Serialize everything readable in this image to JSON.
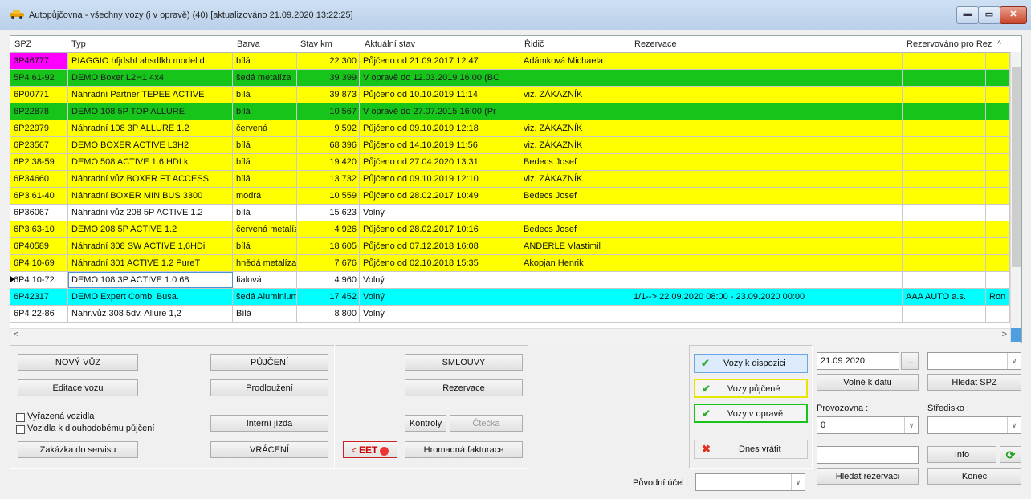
{
  "window": {
    "title": "Autopůjčovna  - všechny vozy (i v opravě) (40) [aktualizováno 21.09.2020 13:22:25]",
    "min_icon": "minimize-icon",
    "max_icon": "maximize-icon",
    "close_icon": "close-icon"
  },
  "grid": {
    "columns": [
      "SPZ",
      "Typ",
      "Barva",
      "Stav km",
      "Aktuální stav",
      "Řidič",
      "Rezervace",
      "Rezervováno pro Rez"
    ],
    "rows": [
      {
        "spz": "3P46777",
        "typ": "PIAGGIO hfjdshf ahsdfkh model d",
        "barva": "bílá",
        "km": "22 300",
        "stav": "Půjčeno od 21.09.2017 12:47",
        "ridic": "Adámková Michaela",
        "rez": "",
        "rezpro": "",
        "color": "yellow",
        "spz_magenta": true
      },
      {
        "spz": "5P4 61-92",
        "typ": "DEMO Boxer L2H1 4x4",
        "barva": "šedá metalíza",
        "km": "39 399",
        "stav": "V opravě do 12.03.2019 16:00 (BC",
        "ridic": "",
        "rez": "",
        "rezpro": "",
        "color": "green"
      },
      {
        "spz": "6P00771",
        "typ": "Náhradní Partner TEPEE ACTIVE",
        "barva": "bílá",
        "km": "39 873",
        "stav": "Půjčeno od 10.10.2019 11:14",
        "ridic": "viz. ZÁKAZNÍK",
        "rez": "",
        "rezpro": "",
        "color": "yellow"
      },
      {
        "spz": "6P22878",
        "typ": "DEMO 108 5P TOP ALLURE",
        "barva": "bílá",
        "km": "10 567",
        "stav": "V opravě do 27.07.2015 16:00 (Pr",
        "ridic": "",
        "rez": "",
        "rezpro": "",
        "color": "green"
      },
      {
        "spz": "6P22979",
        "typ": "Náhradní 108 3P ALLURE 1.2",
        "barva": "červená",
        "km": "9 592",
        "stav": "Půjčeno od 09.10.2019 12:18",
        "ridic": "viz. ZÁKAZNÍK",
        "rez": "",
        "rezpro": "",
        "color": "yellow"
      },
      {
        "spz": "6P23567",
        "typ": "DEMO BOXER ACTIVE L3H2",
        "barva": "bílá",
        "km": "68 396",
        "stav": "Půjčeno od 14.10.2019 11:56",
        "ridic": "viz. ZÁKAZNÍK",
        "rez": "",
        "rezpro": "",
        "color": "yellow"
      },
      {
        "spz": "6P2 38-59",
        "typ": "DEMO 508 ACTIVE 1.6 HDI k",
        "barva": "bílá",
        "km": "19 420",
        "stav": "Půjčeno od 27.04.2020 13:31",
        "ridic": "Bedecs Josef",
        "rez": "",
        "rezpro": "",
        "color": "yellow"
      },
      {
        "spz": "6P34660",
        "typ": "Náhradní vůz BOXER FT ACCESS",
        "barva": "bílá",
        "km": "13 732",
        "stav": "Půjčeno od 09.10.2019 12:10",
        "ridic": "viz. ZÁKAZNÍK",
        "rez": "",
        "rezpro": "",
        "color": "yellow"
      },
      {
        "spz": "6P3 61-40",
        "typ": "Náhradní  BOXER MINIBUS 3300",
        "barva": "modrá",
        "km": "10 559",
        "stav": "Půjčeno od 28.02.2017 10:49",
        "ridic": "Bedecs Josef",
        "rez": "",
        "rezpro": "",
        "color": "yellow"
      },
      {
        "spz": "6P36067",
        "typ": "Náhradní vůz 208 5P ACTIVE 1.2",
        "barva": "bílá",
        "km": "15 623",
        "stav": "Volný",
        "ridic": "",
        "rez": "",
        "rezpro": "",
        "color": "white"
      },
      {
        "spz": "6P3 63-10",
        "typ": "DEMO 208 5P ACTIVE 1.2",
        "barva": "červená metalíz",
        "km": "4 926",
        "stav": "Půjčeno od 28.02.2017 10:16",
        "ridic": "Bedecs Josef",
        "rez": "",
        "rezpro": "",
        "color": "yellow"
      },
      {
        "spz": "6P40589",
        "typ": "Náhradní 308 SW ACTIVE 1,6HDi",
        "barva": "bílá",
        "km": "18 605",
        "stav": "Půjčeno od 07.12.2018 16:08",
        "ridic": "ANDERLE Vlastimil",
        "rez": "",
        "rezpro": "",
        "color": "yellow"
      },
      {
        "spz": "6P4 10-69",
        "typ": "Náhradní 301 ACTIVE 1.2 PureT",
        "barva": "hnědá metalíza",
        "km": "7 676",
        "stav": "Půjčeno od 02.10.2018 15:35",
        "ridic": "Akopjan Henrik",
        "rez": "",
        "rezpro": "",
        "color": "yellow"
      },
      {
        "spz": "6P4 10-72",
        "typ": "DEMO 108 3P ACTIVE 1.0 68",
        "barva": "fialová",
        "km": "4 960",
        "stav": "Volný",
        "ridic": "",
        "rez": "",
        "rezpro": "",
        "color": "white",
        "selected": true
      },
      {
        "spz": "6P42317",
        "typ": "DEMO Expert Combi Busa.",
        "barva": "šedá Aluminium",
        "km": "17 452",
        "stav": "Volný",
        "ridic": "",
        "rez": "1/1--> 22.09.2020 08:00 - 23.09.2020 00:00",
        "rezpro": "AAA AUTO a.s.",
        "rezx": "Ron",
        "color": "cyan"
      },
      {
        "spz": "6P4 22-86",
        "typ": "Náhr.vůz 308 5dv. Allure 1,2",
        "barva": "Bílá",
        "km": "8 800",
        "stav": "Volný",
        "ridic": "",
        "rez": "",
        "rezpro": "",
        "color": "white"
      }
    ]
  },
  "buttons": {
    "novy_vuz": "NOVÝ VŮZ",
    "editace_vozu": "Editace vozu",
    "pujceni": "PŮJČENÍ",
    "prodlouzeni": "Prodloužení",
    "smlouvy": "SMLOUVY",
    "rezervace": "Rezervace",
    "interni_jizda": "Interní jízda",
    "vraceni": "VRÁCENÍ",
    "kontroly": "Kontroly",
    "ctecka": "Čtečka",
    "eet": "EET",
    "hromadna": "Hromadná fakturace",
    "zakazka": "Zakázka do servisu",
    "vozy_k_dispozici": "Vozy k dispozici",
    "vozy_pujcene": "Vozy půjčené",
    "vozy_v_oprave": "Vozy v opravě",
    "dnes_vratit": "Dnes vrátit",
    "volne_k_datu": "Volné k datu",
    "hledat_spz": "Hledat SPZ",
    "info": "Info",
    "hledat_rezervaci": "Hledat rezervaci",
    "konec": "Konec",
    "date_picker": "..."
  },
  "checkboxes": {
    "vyrazena": "Vyřazená vozidla",
    "dlouhodobe": "Vozidla k dlouhodobému půjčení"
  },
  "fields": {
    "datum": "21.09.2020",
    "provozovna_label": "Provozovna :",
    "provozovna_value": "0",
    "stredisko_label": "Středisko :",
    "stredisko_value": "",
    "spz_select": "",
    "puvodni_ucel_label": "Původní účel :",
    "puvodni_ucel_value": "",
    "rezervace_text": ""
  }
}
